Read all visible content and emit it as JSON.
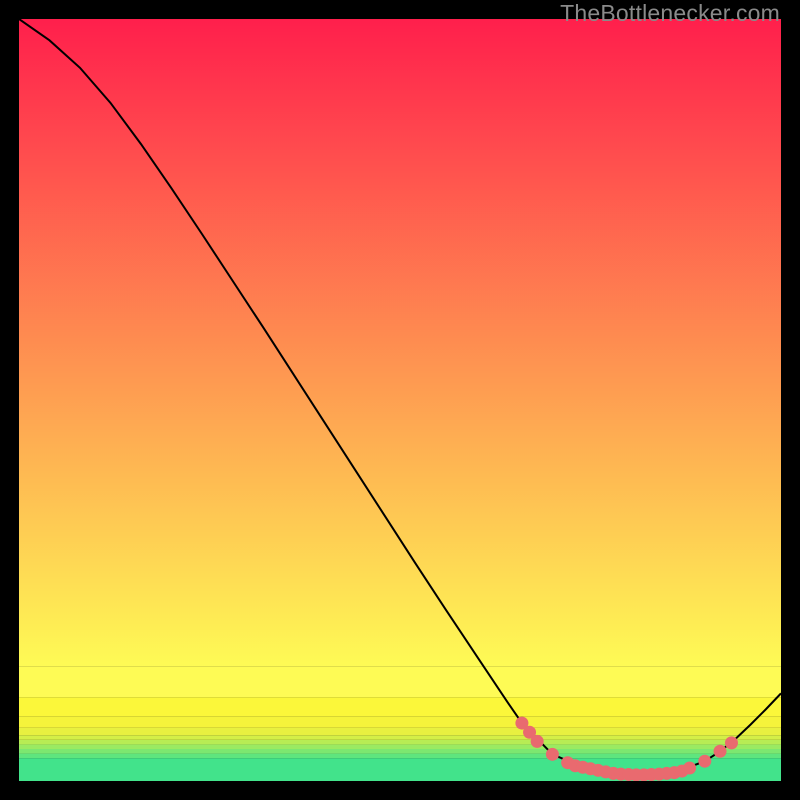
{
  "watermark": "TheBottlenecker.com",
  "chart_data": {
    "type": "line",
    "title": "",
    "xlabel": "",
    "ylabel": "",
    "xlim": [
      0,
      100
    ],
    "ylim": [
      0,
      100
    ],
    "background_bands": [
      {
        "y0": 0.0,
        "y1": 3.0,
        "color": "#42e38b"
      },
      {
        "y0": 3.0,
        "y1": 3.6,
        "color": "#5fe57e"
      },
      {
        "y0": 3.6,
        "y1": 4.2,
        "color": "#7de770"
      },
      {
        "y0": 4.2,
        "y1": 4.8,
        "color": "#9aea62"
      },
      {
        "y0": 4.8,
        "y1": 5.4,
        "color": "#b7ec54"
      },
      {
        "y0": 5.4,
        "y1": 6.0,
        "color": "#d4ef47"
      },
      {
        "y0": 6.0,
        "y1": 7.0,
        "color": "#e8f040"
      },
      {
        "y0": 7.0,
        "y1": 8.5,
        "color": "#f5f33b"
      },
      {
        "y0": 8.5,
        "y1": 11.0,
        "color": "#fbf73a"
      },
      {
        "y0": 11.0,
        "y1": 15.0,
        "color": "#fefb55"
      }
    ],
    "background_gradient": {
      "top_color": "#ff1f4c",
      "bottom_color": "#fefb55",
      "from_y": 100,
      "to_y": 15
    },
    "series": [
      {
        "name": "curve",
        "type": "line",
        "color": "#000000",
        "x": [
          0,
          4,
          8,
          12,
          16,
          20,
          24,
          28,
          32,
          36,
          40,
          44,
          48,
          52,
          56,
          60,
          64,
          66,
          70,
          74,
          78,
          82,
          86,
          90,
          92,
          94,
          96,
          98,
          100
        ],
        "y": [
          100,
          97.2,
          93.6,
          89.0,
          83.6,
          77.8,
          71.8,
          65.7,
          59.6,
          53.4,
          47.2,
          41.0,
          34.8,
          28.6,
          22.5,
          16.5,
          10.5,
          7.6,
          3.5,
          1.8,
          1.0,
          0.8,
          1.1,
          2.6,
          3.9,
          5.5,
          7.4,
          9.4,
          11.5
        ]
      },
      {
        "name": "markers",
        "type": "scatter",
        "color": "#e96a6f",
        "x": [
          66,
          67,
          68,
          70,
          72,
          73,
          74,
          75,
          76,
          77,
          78,
          79,
          80,
          81,
          82,
          83,
          84,
          85,
          86,
          87,
          88,
          90,
          92,
          93.5
        ],
        "y": [
          7.6,
          6.4,
          5.2,
          3.5,
          2.4,
          2.0,
          1.8,
          1.6,
          1.4,
          1.2,
          1.0,
          0.9,
          0.85,
          0.8,
          0.8,
          0.85,
          0.9,
          1.0,
          1.1,
          1.3,
          1.7,
          2.6,
          3.9,
          5.0
        ]
      }
    ]
  }
}
